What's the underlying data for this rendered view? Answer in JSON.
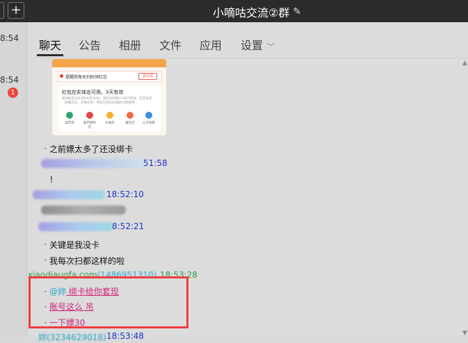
{
  "titlebar": {
    "title": "小嘀咕交流②群",
    "plus_label": "+",
    "edit_icon": "✎"
  },
  "leftbar": {
    "times": [
      "8:54",
      "8:54"
    ],
    "badge": "1"
  },
  "tabs": [
    {
      "label": "聊天"
    },
    {
      "label": "公告"
    },
    {
      "label": "相册"
    },
    {
      "label": "文件"
    },
    {
      "label": "应用"
    },
    {
      "label": "设置"
    }
  ],
  "card": {
    "row1_text": "提醒我每天扫码领红包",
    "row1_button": "去订阅",
    "title": "红包在实体店可用。3天有效",
    "desc": "新领取至2023年06月30日，领红包的用户3天内有效，在实体店（如餐饮店、水果店等）用支付宝扫码/刷脸付款使用",
    "icons": [
      "菜市场",
      "超市便利店",
      "水果店",
      "餐饮店",
      "公交地铁"
    ]
  },
  "messages": {
    "m1": "之前嫖太多了还没绑卡",
    "h1_time": "51:58",
    "m2": "！",
    "h2_time": "18:52:10",
    "h3_time": "8:52:21",
    "m3": "关键是我没卡",
    "m4": "我每次扫都这样的啦",
    "h4_name": "xiaodiaugfa.com",
    "h4_id": "(1486951310)",
    "h4_time": "18:53:28",
    "m5_at": "@妳",
    "m5_text": " 绑卡给你套现",
    "m6": "账号这么 吊",
    "m7": "一下嫖30",
    "h5_name": "妳(3234629018)",
    "h5_time": "18:53:48"
  },
  "colors": {
    "titlebar": "#2b2b2b",
    "highlight_box": "#f03c3c",
    "link_pink": "#d0247c"
  }
}
